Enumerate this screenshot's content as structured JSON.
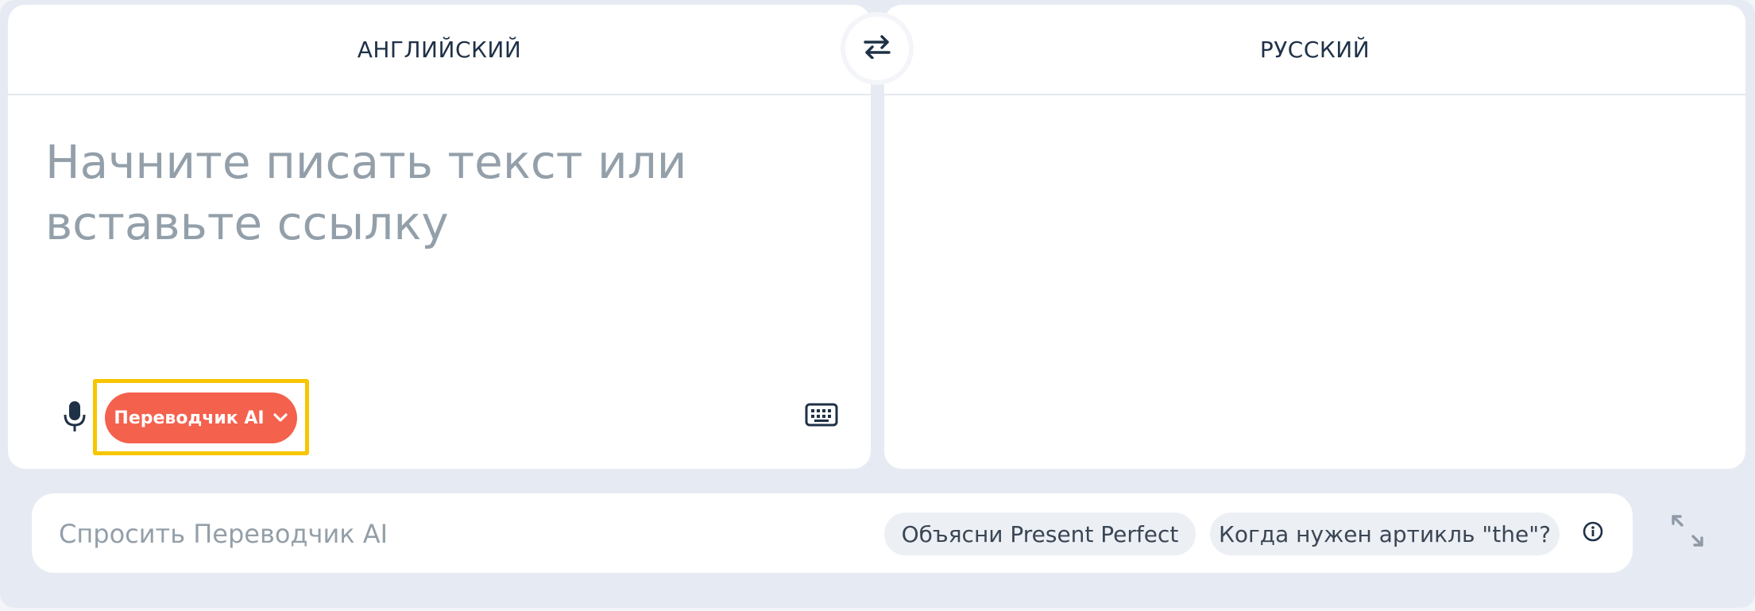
{
  "source_language": {
    "label": "АНГЛИЙСКИЙ"
  },
  "target_language": {
    "label": "РУССКИЙ"
  },
  "swap_button": {
    "icon": "swap-arrows-icon"
  },
  "source_input": {
    "value": "",
    "placeholder": "Начните писать текст или вставьте ссылку"
  },
  "toolbar": {
    "mic_icon": "microphone-icon",
    "ai_mode_label": "Переводчик AI",
    "ai_mode_icon": "chevron-down-icon",
    "keyboard_icon": "keyboard-icon"
  },
  "ask_bar": {
    "placeholder": "Спросить Переводчик AI",
    "value": "",
    "suggestions": [
      {
        "label": "Объясни Present Perfect"
      },
      {
        "label": "Когда нужен артикль \"the\"?"
      }
    ],
    "info_icon": "info-icon"
  },
  "expand_icon": "expand-arrows-icon",
  "colors": {
    "accent": "#f4614d",
    "highlight": "#f7c600",
    "placeholder": "#939fa9",
    "heading": "#1f3147",
    "background": "#e6ebf3"
  }
}
